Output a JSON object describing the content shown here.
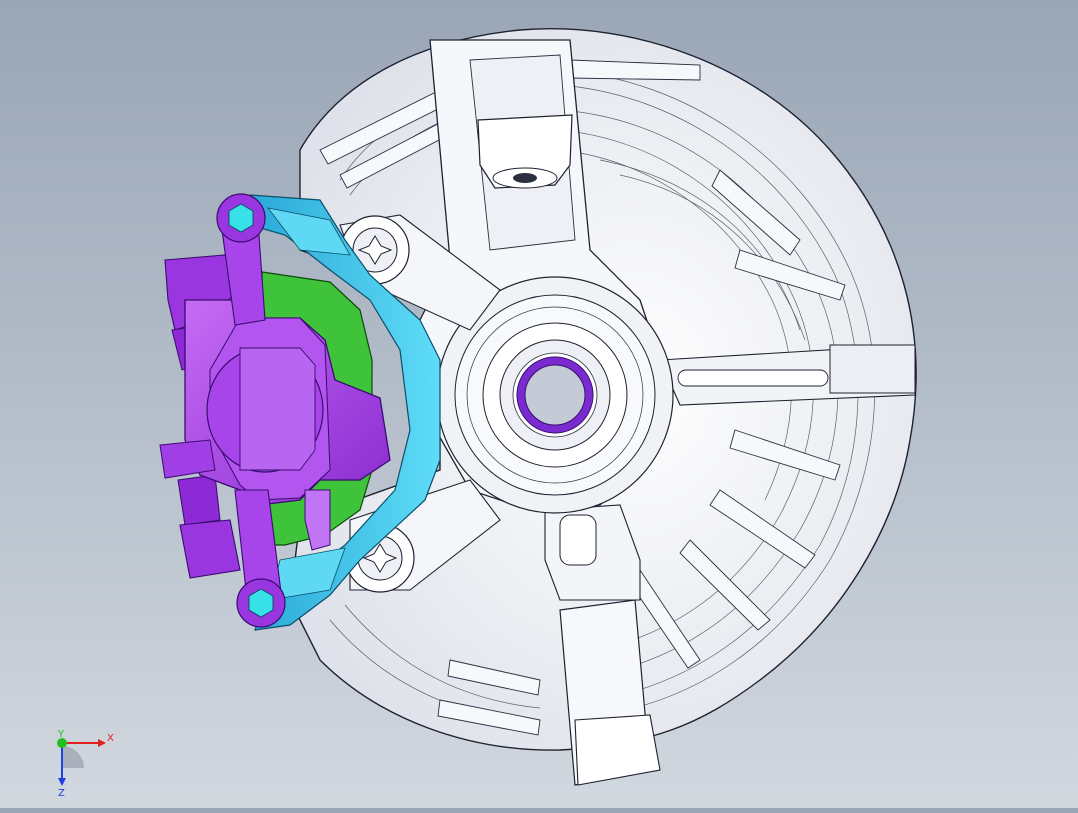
{
  "viewport": {
    "colors": {
      "bg_top": "#9aa6b6",
      "bg_bottom": "#d2d8df",
      "shield": "#f4f5f8",
      "edge": "#1e2230",
      "caliper": "#a43fe8",
      "caliper_dark": "#6b1aa8",
      "bracket": "#34c3ea",
      "pad": "#3fc33a",
      "bolt_head": "#38e0e8",
      "bearing_ring": "#7a2bd0"
    }
  },
  "triad": {
    "x_label": "X",
    "y_label": "Y",
    "z_label": "Z",
    "x_color": "#e02020",
    "y_color": "#20c020",
    "z_color": "#2040e0"
  }
}
